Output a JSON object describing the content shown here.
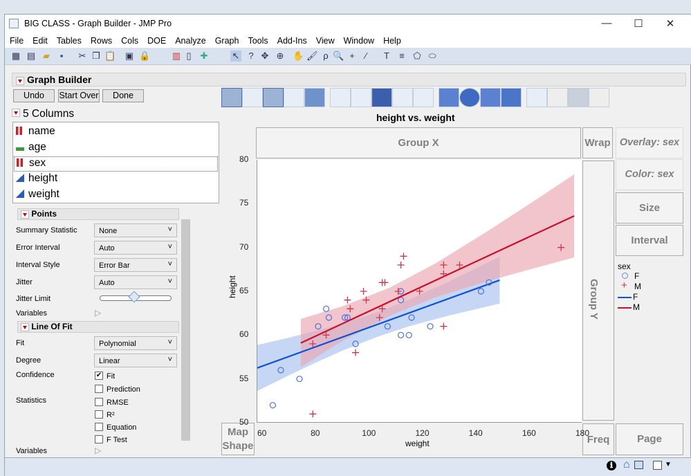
{
  "window": {
    "title": "BIG CLASS - Graph Builder - JMP Pro",
    "min": "—",
    "max": "☐",
    "close": "✕"
  },
  "menu": [
    "File",
    "Edit",
    "Tables",
    "Rows",
    "Cols",
    "DOE",
    "Analyze",
    "Graph",
    "Tools",
    "Add-Ins",
    "View",
    "Window",
    "Help"
  ],
  "panel": {
    "title": "Graph Builder",
    "undo": "Undo",
    "start_over": "Start Over",
    "done": "Done",
    "columns_header": "5 Columns",
    "columns": [
      {
        "name": "name",
        "type": "nominal"
      },
      {
        "name": "age",
        "type": "ordinal"
      },
      {
        "name": "sex",
        "type": "nominal"
      },
      {
        "name": "height",
        "type": "continuous"
      },
      {
        "name": "weight",
        "type": "continuous"
      }
    ]
  },
  "points": {
    "title": "Points",
    "summary_statistic_label": "Summary Statistic",
    "summary_statistic": "None",
    "error_interval_label": "Error Interval",
    "error_interval": "Auto",
    "interval_style_label": "Interval Style",
    "interval_style": "Error Bar",
    "jitter_label": "Jitter",
    "jitter": "Auto",
    "jitter_limit_label": "Jitter Limit",
    "jitter_limit": 0.5,
    "variables_label": "Variables"
  },
  "line_of_fit": {
    "title": "Line Of Fit",
    "fit_label": "Fit",
    "fit": "Polynomial",
    "degree_label": "Degree",
    "degree": "Linear",
    "confidence_label": "Confidence",
    "statistics_label": "Statistics",
    "variables_label": "Variables",
    "options": [
      {
        "label": "Fit",
        "checked": true
      },
      {
        "label": "Prediction",
        "checked": false
      },
      {
        "label": "RMSE",
        "checked": false
      },
      {
        "label": "R²",
        "checked": false
      },
      {
        "label": "Equation",
        "checked": false
      },
      {
        "label": "F Test",
        "checked": false
      }
    ]
  },
  "zones": {
    "group_x": "Group X",
    "group_y": "Group Y",
    "wrap": "Wrap",
    "overlay": "Overlay: sex",
    "color": "Color: sex",
    "size": "Size",
    "interval": "Interval",
    "freq": "Freq",
    "page": "Page",
    "map_shape_1": "Map",
    "map_shape_2": "Shape"
  },
  "legend": {
    "title": "sex",
    "items": [
      {
        "label": "F",
        "kind": "circle"
      },
      {
        "label": "M",
        "kind": "plus"
      },
      {
        "label": "F",
        "kind": "line-blue"
      },
      {
        "label": "M",
        "kind": "line-red"
      }
    ]
  },
  "colors": {
    "F": "#4a6fe0",
    "M": "#d0344a",
    "F_line": "#0f52d6",
    "M_line": "#c8102e",
    "F_band": "#a9c4f0",
    "M_band": "#eba9b3"
  },
  "chart_data": {
    "type": "scatter",
    "title": "height vs. weight",
    "xlabel": "weight",
    "ylabel": "height",
    "xlim": [
      58.2,
      180
    ],
    "ylim": [
      50,
      80
    ],
    "xticks": [
      60,
      80,
      100,
      120,
      140,
      160,
      180
    ],
    "yticks": [
      50,
      55,
      60,
      65,
      70,
      75,
      80
    ],
    "series": [
      {
        "name": "F",
        "marker": "circle",
        "points": [
          [
            64,
            52
          ],
          [
            67,
            56
          ],
          [
            74,
            55
          ],
          [
            81,
            61
          ],
          [
            84,
            63
          ],
          [
            85,
            62
          ],
          [
            91,
            62
          ],
          [
            92,
            62
          ],
          [
            95,
            59
          ],
          [
            107,
            61
          ],
          [
            112,
            60
          ],
          [
            115,
            60
          ],
          [
            112,
            65
          ],
          [
            112,
            64
          ],
          [
            116,
            62
          ],
          [
            123,
            61
          ],
          [
            142,
            65
          ],
          [
            145,
            66
          ]
        ],
        "fit": {
          "x": [
            58.2,
            149
          ],
          "y": [
            56.25,
            66.27
          ]
        },
        "band": {
          "x": [
            58.2,
            70,
            80,
            90,
            103,
            115,
            130,
            149
          ],
          "lo": [
            53.63,
            55.4,
            56.85,
            58.22,
            59.79,
            61.0,
            62.23,
            63.6
          ],
          "hi": [
            58.87,
            59.7,
            60.47,
            61.3,
            62.59,
            64.04,
            66.11,
            68.94
          ]
        }
      },
      {
        "name": "M",
        "marker": "plus",
        "points": [
          [
            79,
            51
          ],
          [
            79,
            59
          ],
          [
            84,
            60
          ],
          [
            92,
            64
          ],
          [
            93,
            63
          ],
          [
            98,
            65
          ],
          [
            99,
            64
          ],
          [
            95,
            58
          ],
          [
            104,
            62
          ],
          [
            105,
            63
          ],
          [
            105,
            66
          ],
          [
            106,
            66
          ],
          [
            111,
            65
          ],
          [
            112,
            68
          ],
          [
            113,
            69
          ],
          [
            119,
            65
          ],
          [
            128,
            68
          ],
          [
            128,
            67
          ],
          [
            134,
            68
          ],
          [
            128,
            61
          ],
          [
            172,
            70
          ]
        ],
        "fit": {
          "x": [
            74.5,
            176.9
          ],
          "y": [
            59.1,
            73.6
          ]
        },
        "band": {
          "x": [
            74.5,
            90,
            108,
            125,
            145,
            160,
            176.9
          ],
          "lo": [
            56.35,
            59.31,
            62.24,
            64.31,
            66.2,
            67.47,
            68.86
          ],
          "hi": [
            61.85,
            63.27,
            65.44,
            68.19,
            71.96,
            74.93,
            78.34
          ]
        }
      }
    ]
  },
  "status": {
    "info": "ℹ",
    "home": "⌂",
    "select": "▼"
  }
}
